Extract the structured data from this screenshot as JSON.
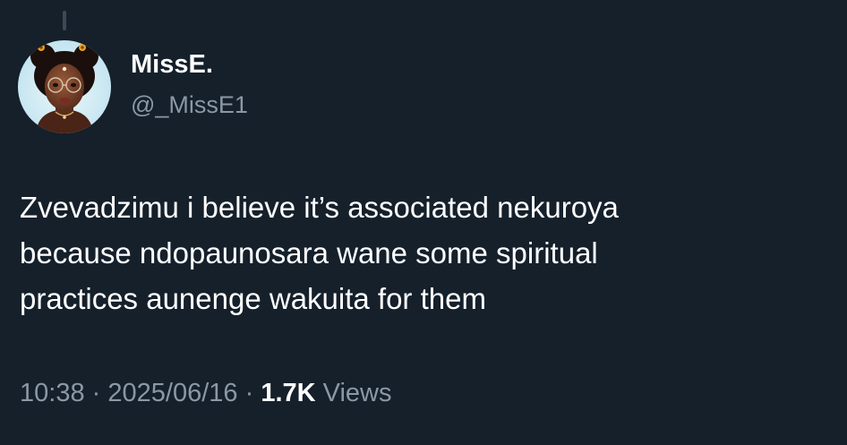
{
  "author": {
    "display_name": "MissE.",
    "handle": "@_MissE1",
    "avatar_icon": "profile-avatar"
  },
  "tweet": {
    "lines": [
      "Zvevadzimu i believe it’s associated nekuroya",
      "because ndopaunosara wane some spiritual",
      "practices aunenge wakuita for them"
    ]
  },
  "meta": {
    "time": "10:38",
    "separator": "·",
    "date": "2025/06/16",
    "views_count": "1.7K",
    "views_label": "Views"
  },
  "colors": {
    "background": "#15202b",
    "text_primary": "#ffffff",
    "text_secondary": "#8b98a5"
  }
}
